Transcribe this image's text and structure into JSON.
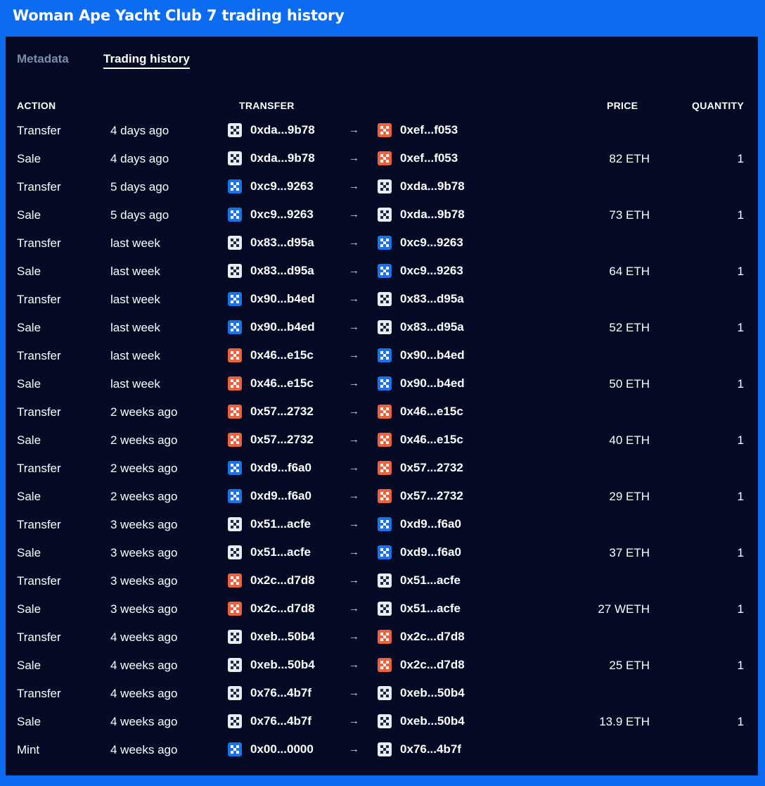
{
  "title": "Woman Ape Yacht Club 7 trading history",
  "tabs": {
    "metadata": "Metadata",
    "trading_history": "Trading history"
  },
  "headers": {
    "action": "ACTION",
    "transfer": "TRANSFER",
    "price": "PRICE",
    "quantity": "QUANTITY"
  },
  "arrow": "→",
  "avatar_colors": {
    "0xda...9b78": "#e9edf2",
    "0xef...f053": "#f0623d",
    "0xc9...9263": "#1a73e8",
    "0x83...d95a": "#e9edf2",
    "0x90...b4ed": "#1a73e8",
    "0x46...e15c": "#f0623d",
    "0x57...2732": "#f0623d",
    "0xd9...f6a0": "#1a73e8",
    "0x51...acfe": "#e9edf2",
    "0x2c...d7d8": "#f0623d",
    "0xeb...50b4": "#e9edf2",
    "0x76...4b7f": "#e9edf2",
    "0x00...0000": "#1a73e8"
  },
  "rows": [
    {
      "action": "Transfer",
      "time": "4 days ago",
      "from": "0xda...9b78",
      "to": "0xef...f053",
      "price": "",
      "quantity": ""
    },
    {
      "action": "Sale",
      "time": "4 days ago",
      "from": "0xda...9b78",
      "to": "0xef...f053",
      "price": "82 ETH",
      "quantity": "1"
    },
    {
      "action": "Transfer",
      "time": "5 days ago",
      "from": "0xc9...9263",
      "to": "0xda...9b78",
      "price": "",
      "quantity": ""
    },
    {
      "action": "Sale",
      "time": "5 days ago",
      "from": "0xc9...9263",
      "to": "0xda...9b78",
      "price": "73 ETH",
      "quantity": "1"
    },
    {
      "action": "Transfer",
      "time": "last week",
      "from": "0x83...d95a",
      "to": "0xc9...9263",
      "price": "",
      "quantity": ""
    },
    {
      "action": "Sale",
      "time": "last week",
      "from": "0x83...d95a",
      "to": "0xc9...9263",
      "price": "64 ETH",
      "quantity": "1"
    },
    {
      "action": "Transfer",
      "time": "last week",
      "from": "0x90...b4ed",
      "to": "0x83...d95a",
      "price": "",
      "quantity": ""
    },
    {
      "action": "Sale",
      "time": "last week",
      "from": "0x90...b4ed",
      "to": "0x83...d95a",
      "price": "52 ETH",
      "quantity": "1"
    },
    {
      "action": "Transfer",
      "time": "last week",
      "from": "0x46...e15c",
      "to": "0x90...b4ed",
      "price": "",
      "quantity": ""
    },
    {
      "action": "Sale",
      "time": "last week",
      "from": "0x46...e15c",
      "to": "0x90...b4ed",
      "price": "50 ETH",
      "quantity": "1"
    },
    {
      "action": "Transfer",
      "time": "2 weeks ago",
      "from": "0x57...2732",
      "to": "0x46...e15c",
      "price": "",
      "quantity": ""
    },
    {
      "action": "Sale",
      "time": "2 weeks ago",
      "from": "0x57...2732",
      "to": "0x46...e15c",
      "price": "40 ETH",
      "quantity": "1"
    },
    {
      "action": "Transfer",
      "time": "2 weeks ago",
      "from": "0xd9...f6a0",
      "to": "0x57...2732",
      "price": "",
      "quantity": ""
    },
    {
      "action": "Sale",
      "time": "2 weeks ago",
      "from": "0xd9...f6a0",
      "to": "0x57...2732",
      "price": "29 ETH",
      "quantity": "1"
    },
    {
      "action": "Transfer",
      "time": "3 weeks ago",
      "from": "0x51...acfe",
      "to": "0xd9...f6a0",
      "price": "",
      "quantity": ""
    },
    {
      "action": "Sale",
      "time": "3 weeks ago",
      "from": "0x51...acfe",
      "to": "0xd9...f6a0",
      "price": "37 ETH",
      "quantity": "1"
    },
    {
      "action": "Transfer",
      "time": "3 weeks ago",
      "from": "0x2c...d7d8",
      "to": "0x51...acfe",
      "price": "",
      "quantity": ""
    },
    {
      "action": "Sale",
      "time": "3 weeks ago",
      "from": "0x2c...d7d8",
      "to": "0x51...acfe",
      "price": "27 WETH",
      "quantity": "1"
    },
    {
      "action": "Transfer",
      "time": "4 weeks ago",
      "from": "0xeb...50b4",
      "to": "0x2c...d7d8",
      "price": "",
      "quantity": ""
    },
    {
      "action": "Sale",
      "time": "4 weeks ago",
      "from": "0xeb...50b4",
      "to": "0x2c...d7d8",
      "price": "25 ETH",
      "quantity": "1"
    },
    {
      "action": "Transfer",
      "time": "4 weeks ago",
      "from": "0x76...4b7f",
      "to": "0xeb...50b4",
      "price": "",
      "quantity": ""
    },
    {
      "action": "Sale",
      "time": "4 weeks ago",
      "from": "0x76...4b7f",
      "to": "0xeb...50b4",
      "price": "13.9 ETH",
      "quantity": "1"
    },
    {
      "action": "Mint",
      "time": "4 weeks ago",
      "from": "0x00...0000",
      "to": "0x76...4b7f",
      "price": "",
      "quantity": ""
    }
  ]
}
